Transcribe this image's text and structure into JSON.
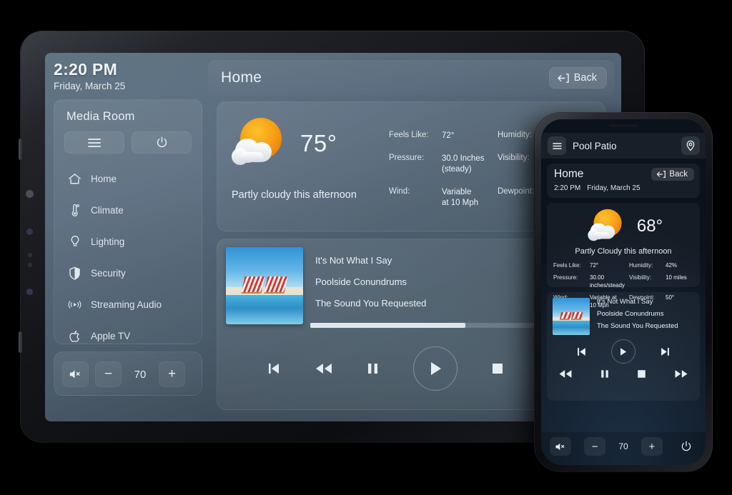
{
  "tablet": {
    "clock": {
      "time": "2:20 PM",
      "date": "Friday, March 25"
    },
    "room": {
      "title": "Media Room",
      "menu_icon": "hamburger-menu-icon",
      "power_icon": "power-icon"
    },
    "nav": [
      {
        "label": "Home",
        "icon": "home-icon"
      },
      {
        "label": "Climate",
        "icon": "thermometer-icon"
      },
      {
        "label": "Lighting",
        "icon": "lightbulb-icon"
      },
      {
        "label": "Security",
        "icon": "shield-icon"
      },
      {
        "label": "Streaming Audio",
        "icon": "broadcast-audio-icon"
      },
      {
        "label": "Apple TV",
        "icon": "apple-icon"
      }
    ],
    "volume": {
      "mute_icon": "mute-speaker-icon",
      "minus": "−",
      "value": "70",
      "plus": "+"
    },
    "topbar": {
      "title": "Home",
      "back_label": "Back",
      "back_icon": "back-arrow-icon"
    },
    "weather": {
      "icon": "sun-behind-cloud-icon",
      "temperature": "75°",
      "condition": "Partly cloudy this afternoon",
      "stats": [
        {
          "key": "Feels Like:",
          "value": "72°"
        },
        {
          "key": "Humidity:",
          "value": ""
        },
        {
          "key": "Pressure:",
          "value": "30.0 Inches (steady)"
        },
        {
          "key": "Visibility:",
          "value": ""
        },
        {
          "key": "Wind:",
          "value": "Variable at 10 Mph"
        },
        {
          "key": "Dewpoint:",
          "value": ""
        }
      ]
    },
    "media": {
      "art": "poolside-album-art",
      "track": "It's Not What I Say",
      "album": "Poolside Conundrums",
      "source": "The Sound You Requested",
      "progress_percent": 55,
      "transport": [
        {
          "name": "previous-track-button",
          "icon": "skip-back-icon"
        },
        {
          "name": "rewind-button",
          "icon": "rewind-icon"
        },
        {
          "name": "pause-button",
          "icon": "pause-icon"
        },
        {
          "name": "play-button",
          "icon": "play-icon"
        },
        {
          "name": "stop-button",
          "icon": "stop-icon"
        },
        {
          "name": "fast-forward-button",
          "icon": "fast-forward-icon"
        }
      ]
    }
  },
  "phone": {
    "topbar": {
      "menu_icon": "hamburger-menu-icon",
      "room": "Pool Patio",
      "location_icon": "location-pin-icon"
    },
    "header": {
      "title": "Home",
      "back_label": "Back",
      "back_icon": "back-arrow-icon",
      "time": "2:20 PM",
      "date": "Friday, March 25"
    },
    "weather": {
      "icon": "sun-behind-cloud-icon",
      "temperature": "68°",
      "condition": "Partly Cloudy this afternoon",
      "stats": [
        {
          "key": "Feels Like:",
          "value": "72°"
        },
        {
          "key": "Humidity:",
          "value": "42%"
        },
        {
          "key": "Pressure:",
          "value": "30.00 inches/steady"
        },
        {
          "key": "Visibility:",
          "value": "10 miles"
        },
        {
          "key": "Wind:",
          "value": "Variable at 10 Mph"
        },
        {
          "key": "Dewpoint:",
          "value": "50°"
        }
      ]
    },
    "media": {
      "art": "poolside-album-art",
      "track": "It's Not What I Say",
      "album": "Poolside Conundrums",
      "source": "The Sound You Requested"
    },
    "volume": {
      "mute_icon": "mute-speaker-icon",
      "minus": "−",
      "value": "70",
      "plus": "+",
      "power_icon": "power-icon"
    }
  },
  "colors": {
    "screen_slate": "#4a5b6a",
    "phone_dark": "#1d2c3d",
    "sun_orange": "#f2920f",
    "text_light": "#e9eff3"
  }
}
